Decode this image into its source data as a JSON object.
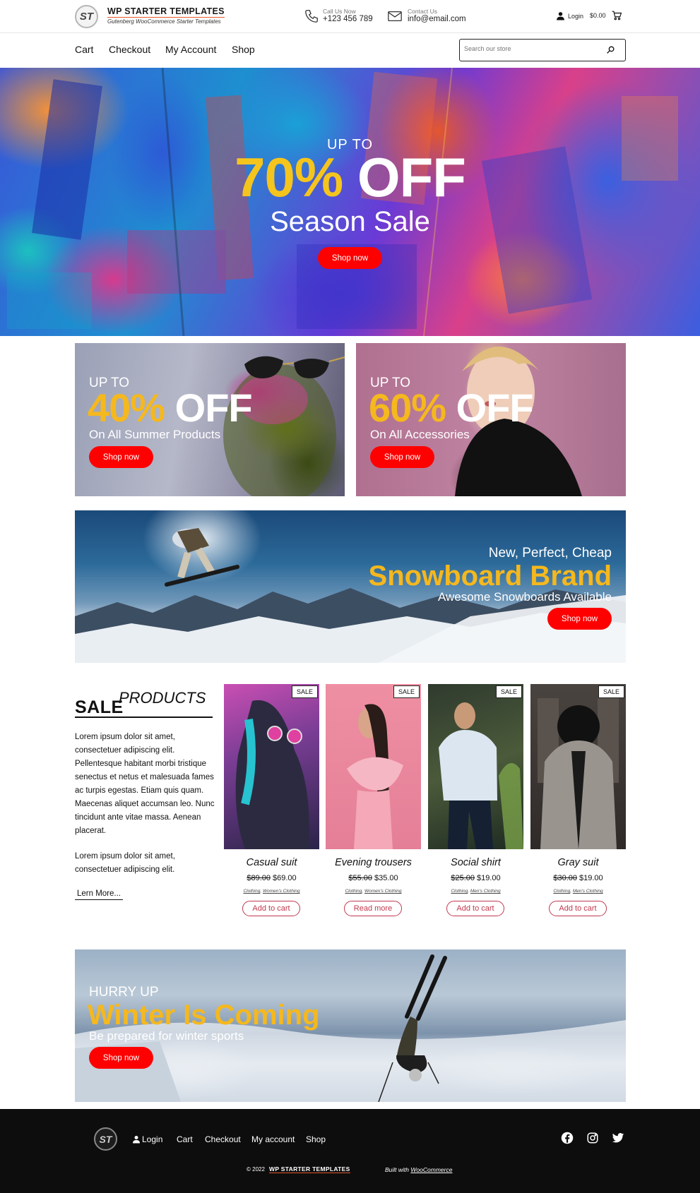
{
  "header": {
    "logo_text": "ST",
    "brand_title": "WP STARTER TEMPLATES",
    "brand_subtitle": "Gutenberg WooCommerce Starter Templates",
    "call_label": "Call Us Now",
    "call_value": "+123 456 789",
    "contact_label": "Contact Us",
    "contact_value": "info@email.com",
    "login_label": "Login",
    "cart_amount": "$0.00"
  },
  "nav": {
    "items": [
      "Cart",
      "Checkout",
      "My Account",
      "Shop"
    ],
    "search_placeholder": "Search our store"
  },
  "hero": {
    "upto": "UP TO",
    "percent": "70%",
    "off": "OFF",
    "subtitle": "Season Sale",
    "button": "Shop now"
  },
  "promos": [
    {
      "upto": "UP TO",
      "percent": "40%",
      "off": "OFF",
      "subtitle": "On All Summer Products",
      "button": "Shop now"
    },
    {
      "upto": "UP TO",
      "percent": "60%",
      "off": "OFF",
      "subtitle": "On All Accessories",
      "button": "Shop now"
    }
  ],
  "snowboard": {
    "line1": "New, Perfect, Cheap",
    "headline": "Snowboard Brand",
    "line3": "Awesome Snowboards Available",
    "button": "Shop now"
  },
  "sale": {
    "title_main": "SALE",
    "title_sup": "PRODUCTS",
    "paragraph1": "Lorem ipsum dolor sit amet, consectetuer adipiscing elit. Pellentesque habitant morbi tristique senectus et netus et malesuada fames ac turpis egestas. Etiam quis quam. Maecenas aliquet accumsan leo. Nunc tincidunt ante vitae massa. Aenean placerat.",
    "paragraph2": "Lorem ipsum dolor sit amet, consectetuer adipiscing elit.",
    "learn_more": "Lern More..."
  },
  "products": [
    {
      "badge": "SALE",
      "name": "Casual suit",
      "old_price": "$89.00",
      "price": "$69.00",
      "cat1": "Clothing",
      "cat2": "Women's Clothing",
      "button": "Add to cart"
    },
    {
      "badge": "SALE",
      "name": "Evening trousers",
      "old_price": "$55.00",
      "price": "$35.00",
      "cat1": "Clothing",
      "cat2": "Women's Clothing",
      "button": "Read more"
    },
    {
      "badge": "SALE",
      "name": "Social shirt",
      "old_price": "$25.00",
      "price": "$19.00",
      "cat1": "Clothing",
      "cat2": "Men's Clothing",
      "button": "Add to cart"
    },
    {
      "badge": "SALE",
      "name": "Gray suit",
      "old_price": "$30.00",
      "price": "$19.00",
      "cat1": "Clothing",
      "cat2": "Men's Clothing",
      "button": "Add to cart"
    }
  ],
  "winter": {
    "line1": "HURRY UP",
    "headline": "Winter Is Coming",
    "line3": "Be prepared for winter sports",
    "button": "Shop now"
  },
  "footer": {
    "logo_text": "ST",
    "nav": [
      "Login",
      "Cart",
      "Checkout",
      "My account",
      "Shop"
    ],
    "copyright": "© 2022",
    "brand": "WP STARTER TEMPLATES",
    "built_prefix": "Built with",
    "built_link": "WooCommerce"
  },
  "colors": {
    "accent_red": "#ff0000",
    "accent_yellow": "#f5c51d",
    "product_button": "#c0394f",
    "footer_bg": "#0d0d0d"
  },
  "icons": {
    "phone": "phone-icon",
    "mail": "mail-icon",
    "user": "user-icon",
    "cart": "cart-icon",
    "search": "search-icon",
    "facebook": "facebook-icon",
    "instagram": "instagram-icon",
    "twitter": "twitter-icon"
  }
}
